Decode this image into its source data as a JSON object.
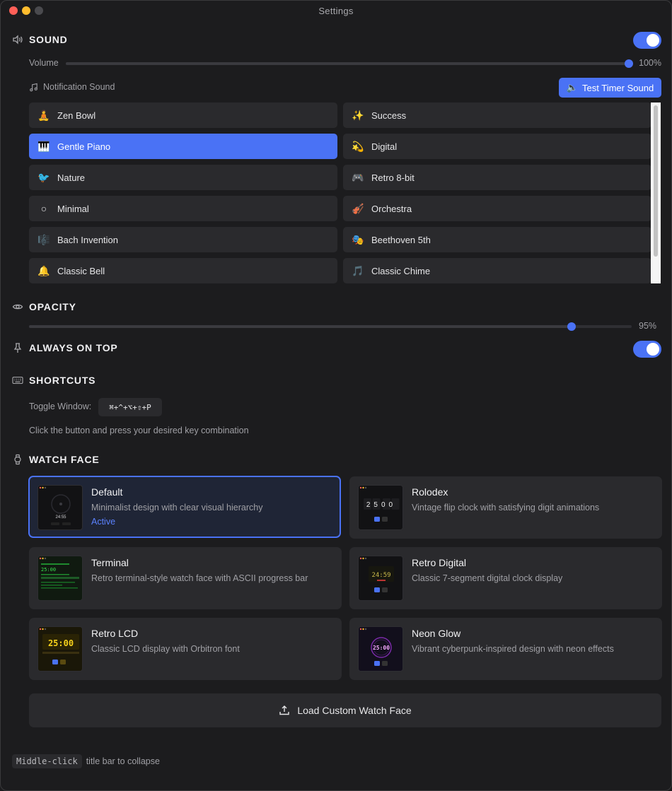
{
  "window": {
    "title": "Settings"
  },
  "sound": {
    "title": "SOUND",
    "enabled": true,
    "volume_label": "Volume",
    "volume_value": "100%",
    "volume_level": 1.0,
    "notification_label": "Notification Sound",
    "test_button": "Test Timer Sound",
    "items": [
      {
        "emoji": "🧘",
        "label": "Zen Bowl",
        "selected": false
      },
      {
        "emoji": "✨",
        "label": "Success",
        "selected": false
      },
      {
        "emoji": "🎹",
        "label": "Gentle Piano",
        "selected": true
      },
      {
        "emoji": "💫",
        "label": "Digital",
        "selected": false
      },
      {
        "emoji": "🐦",
        "label": "Nature",
        "selected": false
      },
      {
        "emoji": "🎮",
        "label": "Retro 8-bit",
        "selected": false
      },
      {
        "emoji": "○",
        "label": "Minimal",
        "selected": false
      },
      {
        "emoji": "🎻",
        "label": "Orchestra",
        "selected": false
      },
      {
        "emoji": "🎼",
        "label": "Bach Invention",
        "selected": false
      },
      {
        "emoji": "🎭",
        "label": "Beethoven 5th",
        "selected": false
      },
      {
        "emoji": "🔔",
        "label": "Classic Bell",
        "selected": false
      },
      {
        "emoji": "🎵",
        "label": "Classic Chime",
        "selected": false
      }
    ]
  },
  "opacity": {
    "title": "OPACITY",
    "value": "95%",
    "level": 0.95
  },
  "always_on_top": {
    "title": "ALWAYS ON TOP",
    "enabled": true
  },
  "shortcuts": {
    "title": "SHORTCUTS",
    "toggle_label": "Toggle Window:",
    "toggle_keys": "⌘+^+⌥+⇧+P",
    "hint": "Click the button and press your desired key combination"
  },
  "watch_face": {
    "title": "WATCH FACE",
    "faces": [
      {
        "title": "Default",
        "desc": "Minimalist design with clear visual hierarchy",
        "status": "Active",
        "active": true,
        "thumb_time": "24:55"
      },
      {
        "title": "Rolodex",
        "desc": "Vintage flip clock with satisfying digit animations",
        "status": "",
        "active": false,
        "thumb_time": "2500"
      },
      {
        "title": "Terminal",
        "desc": "Retro terminal-style watch face with ASCII progress bar",
        "status": "",
        "active": false,
        "thumb_time": "25:00"
      },
      {
        "title": "Retro Digital",
        "desc": "Classic 7-segment digital clock display",
        "status": "",
        "active": false,
        "thumb_time": "24:59"
      },
      {
        "title": "Retro LCD",
        "desc": "Classic LCD display with Orbitron font",
        "status": "",
        "active": false,
        "thumb_time": "25:00"
      },
      {
        "title": "Neon Glow",
        "desc": "Vibrant cyberpunk-inspired design with neon effects",
        "status": "",
        "active": false,
        "thumb_time": "25:00"
      }
    ],
    "load_button": "Load Custom Watch Face"
  },
  "footer": {
    "key": "Middle-click",
    "text": "title bar to collapse"
  },
  "colors": {
    "accent": "#4a72f5",
    "background": "#1c1c1e",
    "card": "#2a2a2d"
  }
}
